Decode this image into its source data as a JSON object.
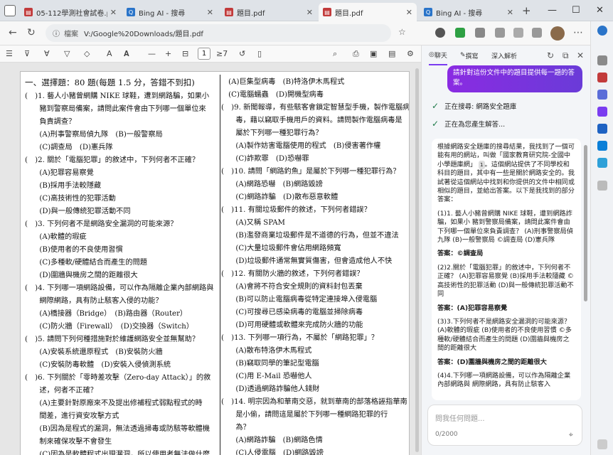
{
  "tabs": [
    {
      "title": "05-112學測社會試卷.pdf",
      "icon": "pdf-tab-icon"
    },
    {
      "title": "Bing AI - 搜尋",
      "icon": "bing-tab-icon"
    },
    {
      "title": "題目.pdf",
      "icon": "pdf-tab-icon"
    },
    {
      "title": "題目.pdf",
      "icon": "pdf-tab-icon",
      "active": true
    },
    {
      "title": "Bing AI - 搜尋",
      "icon": "bing-tab-icon"
    }
  ],
  "address": {
    "label": "檔案",
    "url": "V:/Google%20Downloads/題目.pdf"
  },
  "pdf_toolbar": {
    "page": "1",
    "total": "7"
  },
  "pdf": {
    "heading": "一、選擇題：80 題(每題 1.5 分，答錯不到扣)",
    "left": [
      "(　)1. 藝人小豬曾網購 NIKE 球鞋，遭到網路騙，如果小",
      "　　豬到警察局備案，請問此案件會由下列哪一個單位來",
      "　　負責調查？",
      "　　(A)刑事警察局偵九隊　(B)一般警察局",
      "　　(C)調查局　(D)憲兵隊",
      "(　)2. 關於「電腦犯罪」的敘述中，下列何者不正確？",
      "　　(A)犯罪容易察覺",
      "　　(B)採用手法較隱藏",
      "　　(C)高技術性的犯罪活動",
      "　　(D)與一般傳統犯罪活動不同",
      "(　)3. 下列何者不是網路安全漏洞的可能來源？",
      "　　(A)軟體的瑕疵",
      "　　(B)使用者的不良使用習慣",
      "　　(C)多種軟/硬體結合而產生的問題",
      "　　(D)圍牆與機房之間的距離很大",
      "(　)4. 下列哪一項網路設備，可以作為隔離企業內部網路與",
      "　　網際網路，具有防止駭客入侵的功能？",
      "　　(A)橋接器（Bridge）　(B)路由器（Router）",
      "　　(C)防火牆（Firewall）　(D)交換器（Switch）",
      "(　)5. 請問下列何種措施對於維護網路安全並無幫助？",
      "　　(A)安裝系統還原程式　(B)安裝防火牆",
      "　　(C)安裝防毒軟體　(D)安裝入侵偵測系統",
      "(　)6. 下列關於「零時差攻擊（Zero-day Attack）」的敘",
      "　　述，何者不正確？",
      "　　(A)主要針對原廠來不及提出修補程式弱點程式的時",
      "　　間差，進行資安攻擊方式",
      "　　(B)因為是程式的漏洞，無法透過掃毒或防駭等軟體機",
      "　　制來確保攻擊不會發生",
      "　　(C)因為是軟體程式出現漏洞，所以使用者無法做什麼",
      "　　事情來防止攻擊"
    ],
    "right": [
      "　(A)巨集型病毒　(B)特洛伊木馬程式",
      "　(C)電腦蠕蟲　(D)開機型病毒",
      "(　)9. 新聞報導，有些駭客會鎖定智慧型手機，製作電腦病",
      "　　毒，藉以竊取手機用戶的資料。請問製作電腦病毒是",
      "　　屬於下列哪一種犯罪行為？",
      "　　(A)製作妨害電腦使用的程式　(B)侵害著作權",
      "　　(C)詐欺罪　(D)恐嚇罪",
      "(　)10. 請問「網路釣魚」是屬於下列哪一種犯罪行為？",
      "　　(A)網路恐嚇　(B)網路毀謗",
      "　　(C)網路詐騙　(D)散布惡意軟體",
      "(　)11. 有關垃圾郵件的敘述，下列何者錯誤？",
      "　　(A)又稱 SPAM",
      "　　(B)濫發商業垃圾郵件是不道德的行為，但並不違法",
      "　　(C)大量垃圾郵件會佔用網路頻寬",
      "　　(D)垃圾郵件通常無實質傷害，但會造成他人不快",
      "(　)12. 有關防火牆的敘述，下列何者錯誤？",
      "　　(A)會將不符合安全規則的資料封包丟棄",
      "　　(B)可以防止電腦病毒從特定連接埠入侵電腦",
      "　　(C)可搜尋已感染病毒的電腦並掃除病毒",
      "　　(D)可用硬體或軟體來完成防火牆的功能",
      "(　)13. 下列哪一項行為，不屬於「網路犯罪」？",
      "　　(A)散布特洛伊木馬程式",
      "　　(B)竊取同學的筆記型電腦",
      "　　(C)用 E-Mail 恐嚇他人",
      "　　(D)透過網路詐騙他人錢財",
      "(　)14. 明宗因為和華南交惡，就到華南的部落格誣指華南",
      "　　是小偷，請問這是屬於下列哪一種網路犯罪的行",
      "　　為？",
      "　　(A)網路詐騙　(B)網路色情",
      "　　(C)人侵電腦　(D)網路毀謗",
      "(　)15. 為了規範濫發垃圾郵件的行為，我國政府制定了下"
    ]
  },
  "sidebar": {
    "tabs": [
      "聊天",
      "撰寫",
      "深入解析"
    ],
    "user_message": "請針對這份文件中的題目提供每一題的答案。",
    "status": [
      "正在搜尋: 網路安全題庫",
      "正在為您產生解答..."
    ],
    "answer_intro": "根據網路安全題庫的搜尋結果，我找到了一個可能有用的網站，叫做「國家教育研究院-全國中小學題庫網」",
    "answer_intro2": "。這個網站提供了不同學校和科目的題目，其中有一些是關於網路安全的。我試著從這個網站中找到和你提供的文件中相同或相似的題目，並給出答案。以下是我找到的部分答案：",
    "cite": "1",
    "qa": [
      {
        "q": "(1)1. 藝人小豬曾網購 NIKE 球鞋，遭到網路詐騙，如果小 豬到警察局備案，請問此案件會由下列哪一個單位來負責調查？ (A)刑事警察局偵九隊 (B)一般警察局 ©調查局 (D)憲兵隊",
        "a": "答案：©調查局"
      },
      {
        "q": "(2)2.關於「電腦犯罪」的敘述中，下列何者不正確？ (A)犯罪容易察覺 (B)採用手法較隱藏 ©高技術性的犯罪活動 (D)與一般傳統犯罪活動不同",
        "a": "答案：(A)犯罪容易察覺"
      },
      {
        "q": "(3)3.下列何者不是網路安全漏洞的可能來源？ (A)軟體的瑕疵 (B)使用者的不良使用習慣 ©多種軟/硬體結合而產生的問題 (D)圍牆與機房之間的距離很大",
        "a": "答案：(D)圍牆與機房之間的距離很大"
      },
      {
        "q": "(4)4.下列哪一項網路設備，可以作為隔離企業內部網路與 網際網路，具有防止駭客入",
        "a": ""
      }
    ],
    "input_placeholder": "問我任何問題...",
    "counter": "0/2000"
  }
}
